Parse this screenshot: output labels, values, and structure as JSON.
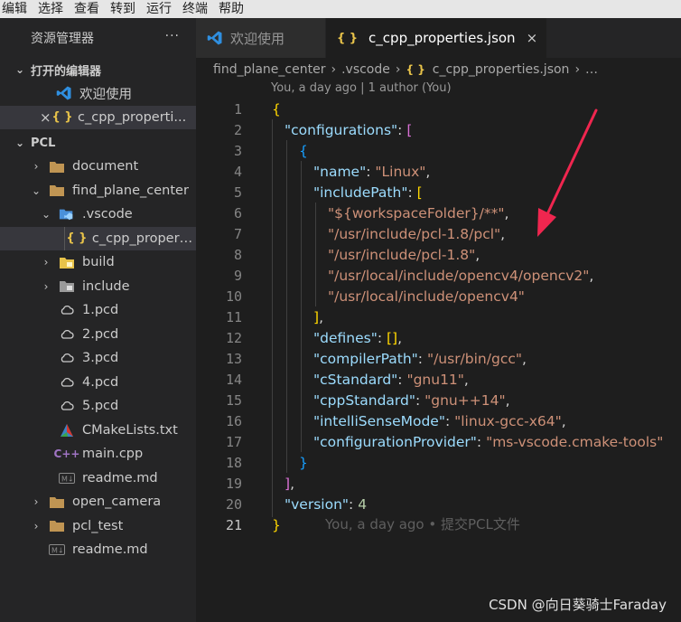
{
  "menu": [
    "编辑",
    "选择",
    "查看",
    "转到",
    "运行",
    "终端",
    "帮助"
  ],
  "sidebar": {
    "title": "资源管理器",
    "more": "···",
    "open_editors_label": "打开的编辑器",
    "open_editors": [
      {
        "label": "欢迎使用",
        "icon": "vscode-icon"
      },
      {
        "label": "c_cpp_properti...",
        "icon": "json-icon",
        "close": "×"
      }
    ],
    "workspace_label": "PCL",
    "tree": [
      {
        "label": "document",
        "type": "folder",
        "chevron": "›",
        "depth": 1
      },
      {
        "label": "find_plane_center",
        "type": "folder",
        "chevron": "⌄",
        "depth": 1
      },
      {
        "label": ".vscode",
        "type": "vscode-folder",
        "chevron": "⌄",
        "depth": 2
      },
      {
        "label": "c_cpp_propert...",
        "type": "json",
        "depth": 3,
        "selected": true
      },
      {
        "label": "build",
        "type": "build-folder",
        "chevron": "›",
        "depth": 2
      },
      {
        "label": "include",
        "type": "include-folder",
        "chevron": "›",
        "depth": 2
      },
      {
        "label": "1.pcd",
        "type": "pcd",
        "depth": 2
      },
      {
        "label": "2.pcd",
        "type": "pcd",
        "depth": 2
      },
      {
        "label": "3.pcd",
        "type": "pcd",
        "depth": 2
      },
      {
        "label": "4.pcd",
        "type": "pcd",
        "depth": 2
      },
      {
        "label": "5.pcd",
        "type": "pcd",
        "depth": 2
      },
      {
        "label": "CMakeLists.txt",
        "type": "cmake",
        "depth": 2
      },
      {
        "label": "main.cpp",
        "type": "cpp",
        "depth": 2
      },
      {
        "label": "readme.md",
        "type": "md",
        "depth": 2
      },
      {
        "label": "open_camera",
        "type": "folder",
        "chevron": "›",
        "depth": 1
      },
      {
        "label": "pcl_test",
        "type": "folder",
        "chevron": "›",
        "depth": 1
      },
      {
        "label": "readme.md",
        "type": "md",
        "depth": 1
      }
    ]
  },
  "tabs": {
    "welcome": "欢迎使用",
    "active": "c_cpp_properties.json",
    "json_glyph": "{ }",
    "close": "×"
  },
  "breadcrumb": {
    "parts": [
      "find_plane_center",
      ".vscode",
      "c_cpp_properties.json",
      "…"
    ],
    "sep": "›"
  },
  "blame_header": "You, a day ago | 1 author (You)",
  "inline_blame": "You, a day ago • 提交PCL文件",
  "code": {
    "line_numbers": [
      "1",
      "2",
      "3",
      "4",
      "5",
      "6",
      "7",
      "8",
      "9",
      "10",
      "11",
      "12",
      "13",
      "14",
      "15",
      "16",
      "17",
      "18",
      "19",
      "20",
      "21"
    ],
    "keys": {
      "configurations": "\"configurations\"",
      "name": "\"name\"",
      "includePath": "\"includePath\"",
      "defines": "\"defines\"",
      "compilerPath": "\"compilerPath\"",
      "cStandard": "\"cStandard\"",
      "cppStandard": "\"cppStandard\"",
      "intelliSenseMode": "\"intelliSenseMode\"",
      "configurationProvider": "\"configurationProvider\"",
      "version": "\"version\""
    },
    "values": {
      "name": "\"Linux\"",
      "include": [
        "\"${workspaceFolder}/**\"",
        "\"/usr/include/pcl-1.8/pcl\"",
        "\"/usr/include/pcl-1.8\"",
        "\"/usr/local/include/opencv4/opencv2\"",
        "\"/usr/local/include/opencv4\""
      ],
      "compilerPath": "\"/usr/bin/gcc\"",
      "cStandard": "\"gnu11\"",
      "cppStandard": "\"gnu++14\"",
      "intelliSenseMode": "\"linux-gcc-x64\"",
      "configurationProvider": "\"ms-vscode.cmake-tools\"",
      "version": "4"
    }
  },
  "watermark": "CSDN @向日葵骑士Faraday",
  "colors": {
    "arrow": "#f0264f",
    "key": "#9cdcfe",
    "string": "#ce9178",
    "number": "#b5cea8"
  }
}
